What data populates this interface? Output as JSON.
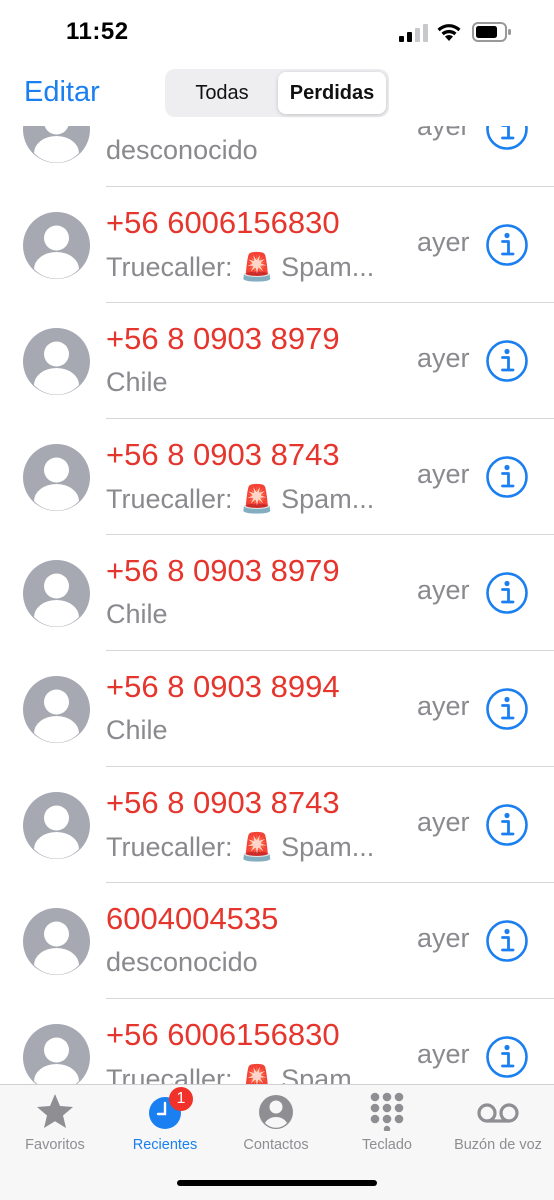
{
  "status_bar": {
    "time": "11:52"
  },
  "nav": {
    "edit_label": "Editar",
    "segments": [
      {
        "label": "Todas",
        "selected": false
      },
      {
        "label": "Perdidas",
        "selected": true
      }
    ]
  },
  "calls": [
    {
      "number": "",
      "subtitle": "desconocido",
      "time": "ayer"
    },
    {
      "number": "+56 6006156830",
      "subtitle": "Truecaller: 🚨 Spam...",
      "time": "ayer"
    },
    {
      "number": "+56 8 0903 8979",
      "subtitle": "Chile",
      "time": "ayer"
    },
    {
      "number": "+56 8 0903 8743",
      "subtitle": "Truecaller: 🚨 Spam...",
      "time": "ayer"
    },
    {
      "number": "+56 8 0903 8979",
      "subtitle": "Chile",
      "time": "ayer"
    },
    {
      "number": "+56 8 0903 8994",
      "subtitle": "Chile",
      "time": "ayer"
    },
    {
      "number": "+56 8 0903 8743",
      "subtitle": "Truecaller: 🚨 Spam...",
      "time": "ayer"
    },
    {
      "number": "6004004535",
      "subtitle": "desconocido",
      "time": "ayer"
    },
    {
      "number": "+56 6006156830",
      "subtitle": "Truecaller: 🚨 Spam...",
      "time": "ayer"
    }
  ],
  "tab_bar": {
    "tabs": [
      {
        "label": "Favoritos",
        "icon": "star-icon",
        "active": false
      },
      {
        "label": "Recientes",
        "icon": "clock-icon",
        "active": true,
        "badge": "1"
      },
      {
        "label": "Contactos",
        "icon": "person-circle-icon",
        "active": false
      },
      {
        "label": "Teclado",
        "icon": "keypad-icon",
        "active": false
      },
      {
        "label": "Buzón de voz",
        "icon": "voicemail-icon",
        "active": false
      }
    ]
  },
  "colors": {
    "accent": "#1a7ff0",
    "missed": "#e5352d",
    "secondary_text": "#8a8a8e",
    "badge": "#f0322b"
  }
}
